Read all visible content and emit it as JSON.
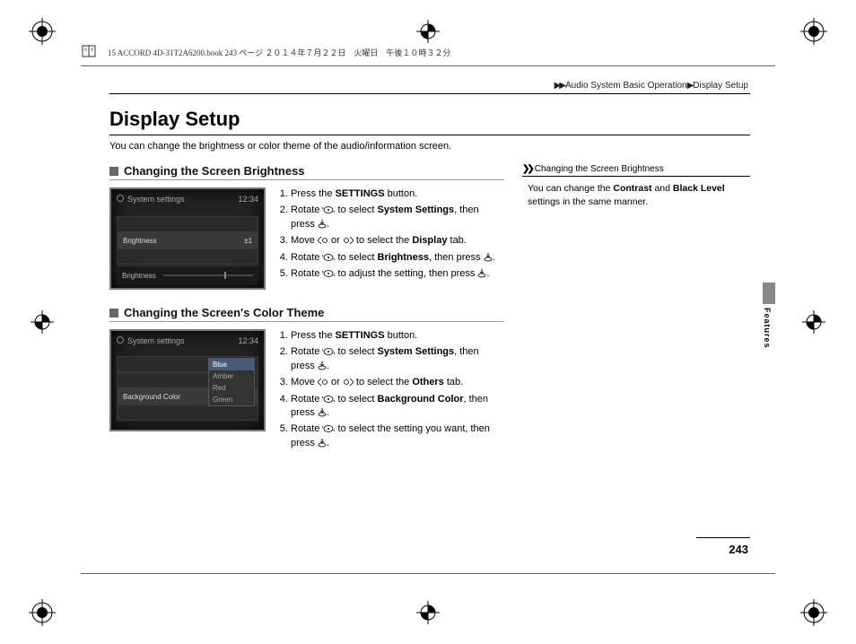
{
  "header_text": "15 ACCORD 4D-31T2A6200.book  243 ページ  ２０１４年７月２２日　火曜日　午後１０時３２分",
  "breadcrumb": {
    "sec1": "Audio System Basic Operation",
    "sec2": "Display Setup"
  },
  "title": "Display Setup",
  "intro": "You can change the brightness or color theme of the audio/information screen.",
  "sec1": {
    "heading": "Changing the Screen Brightness",
    "screen": {
      "title": "System settings",
      "clock": "12:34",
      "row": "Brightness",
      "row_val": "±1",
      "footer": "Brightness"
    },
    "steps": {
      "s1a": "Press the ",
      "s1b": "SETTINGS",
      "s1c": " button.",
      "s2a": "Rotate ",
      "s2b": " to select ",
      "s2c": "System Settings",
      "s2d": ", then press ",
      "s3a": "Move ",
      "s3b": " or ",
      "s3c": " to select the ",
      "s3d": "Display",
      "s3e": " tab.",
      "s4a": "Rotate ",
      "s4b": " to select ",
      "s4c": "Brightness",
      "s4d": ", then press ",
      "s5a": "Rotate ",
      "s5b": " to adjust the setting, then press "
    }
  },
  "sec2": {
    "heading": "Changing the Screen's Color Theme",
    "screen": {
      "title": "System settings",
      "clock": "12:34",
      "row": "Background Color",
      "opts": {
        "o1": "Blue",
        "o2": "Amber",
        "o3": "Red",
        "o4": "Green"
      }
    },
    "steps": {
      "s1a": "Press the ",
      "s1b": "SETTINGS",
      "s1c": " button.",
      "s2a": "Rotate ",
      "s2b": " to select ",
      "s2c": "System Settings",
      "s2d": ", then press ",
      "s3a": "Move ",
      "s3b": " or ",
      "s3c": " to select the ",
      "s3d": "Others",
      "s3e": " tab.",
      "s4a": "Rotate ",
      "s4b": " to select ",
      "s4c": "Background Color",
      "s4d": ", then press ",
      "s5a": "Rotate ",
      "s5b": " to select the setting you want, then press "
    }
  },
  "sidenote": {
    "heading": "Changing the Screen Brightness",
    "t1": "You can change the ",
    "b1": "Contrast",
    "t2": " and ",
    "b2": "Black Level",
    "t3": " settings in the same manner."
  },
  "tab_label": "Features",
  "page_number": "243"
}
